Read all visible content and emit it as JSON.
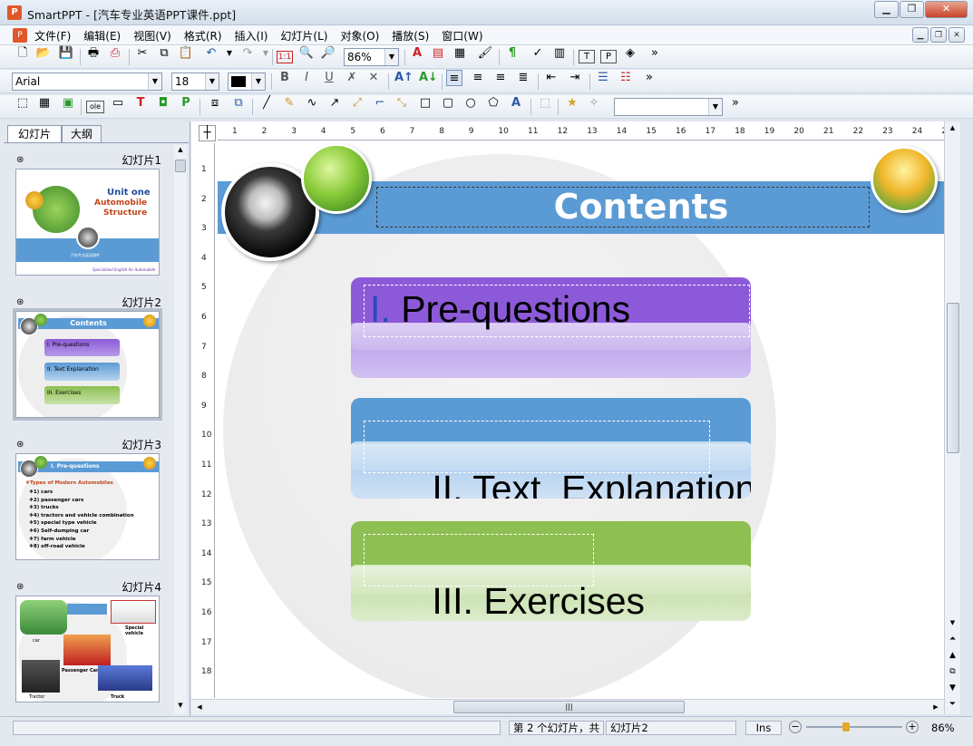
{
  "window": {
    "app_name": "SmartPPT",
    "title": "SmartPPT - [汽车专业英语PPT课件.ppt]",
    "minimize": "▁",
    "maximize": "❐",
    "close": "✕"
  },
  "menu": [
    "文件(F)",
    "编辑(E)",
    "视图(V)",
    "格式(R)",
    "插入(I)",
    "幻灯片(L)",
    "对象(O)",
    "播放(S)",
    "窗口(W)"
  ],
  "mdi_controls": {
    "minimize": "▁",
    "restore": "❐",
    "close": "✕"
  },
  "toolbar1": {
    "zoom_value": "86%",
    "overflow": "»"
  },
  "toolbar2": {
    "font_name": "Arial",
    "font_size": "18",
    "bold": "B",
    "italic": "I",
    "underline": "U",
    "overflow": "»"
  },
  "toolbar3": {
    "ole_label": "ole",
    "overflow": "»"
  },
  "left_tabs": {
    "slides": "幻灯片",
    "outline": "大纲"
  },
  "thumbnails": [
    {
      "label": "幻灯片1",
      "title_line1": "Unit one",
      "title_line2": "Automobile",
      "title_line3": "Structure",
      "sub": "汽车专业英语课件",
      "footer": "Specialized English for Automobile"
    },
    {
      "label": "幻灯片2",
      "title": "Contents",
      "items": [
        "I. Pre-questions",
        "II. Text  Explanation",
        "III. Exercises"
      ]
    },
    {
      "label": "幻灯片3",
      "title": "I. Pre-questions",
      "heading": "❖Types of Modern Automobiles",
      "items": [
        "❖1) cars",
        "❖2) passenger cars",
        "❖3) trucks",
        "❖4) tractors and vehicle combination",
        "❖5) special type vehicle",
        "❖6) Self-dumping car",
        "❖7) farm vehicle",
        "❖8) off-road vehicle"
      ]
    },
    {
      "label": "幻灯片4",
      "captions": [
        "car",
        "Special vehicle",
        "Passenger Cars",
        "Tractor",
        "Truck"
      ]
    }
  ],
  "ruler_h": [
    "1",
    "2",
    "3",
    "4",
    "5",
    "6",
    "7",
    "8",
    "9",
    "10",
    "11",
    "12",
    "13",
    "14",
    "15",
    "16",
    "17",
    "18",
    "19",
    "20",
    "21",
    "22",
    "23",
    "24",
    "2"
  ],
  "ruler_v": [
    "1",
    "2",
    "3",
    "4",
    "5",
    "6",
    "7",
    "8",
    "9",
    "10",
    "11",
    "12",
    "13",
    "14",
    "15",
    "16",
    "17",
    "18"
  ],
  "slide": {
    "title": "Contents",
    "items": [
      {
        "numeral": "I.",
        "text": "Pre-questions"
      },
      {
        "numeral": "II.",
        "text": "Text  Explanation"
      },
      {
        "numeral": "III.",
        "text": "Exercises"
      }
    ]
  },
  "status": {
    "slide_info": "第 2 个幻灯片，共",
    "slide_name": "幻灯片2",
    "mode": "Ins",
    "zoom": "86%"
  },
  "colors": {
    "title_bar": "#5b9bd5",
    "item1": "#8c5ad8",
    "item2": "#5b9bd5",
    "item3": "#8dbf52"
  }
}
